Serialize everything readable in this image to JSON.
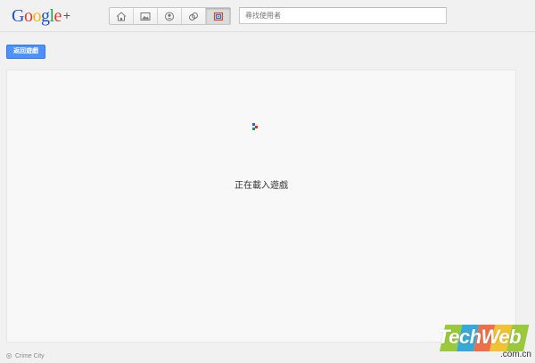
{
  "header": {
    "logo": {
      "letters": [
        "G",
        "o",
        "o",
        "g",
        "l",
        "e"
      ],
      "letter_colors": [
        "#1a52c9",
        "#dd3a2b",
        "#f5b50b",
        "#1a52c9",
        "#1ea54b",
        "#dd3a2b"
      ],
      "plus": "+"
    },
    "nav": [
      {
        "icon": "home-icon",
        "active": false
      },
      {
        "icon": "photos-icon",
        "active": false
      },
      {
        "icon": "profile-icon",
        "active": false
      },
      {
        "icon": "circles-icon",
        "active": false
      },
      {
        "icon": "games-icon",
        "active": true
      }
    ],
    "search": {
      "placeholder": "尋找使用者",
      "value": ""
    }
  },
  "main": {
    "back_button_label": "返回遊戲",
    "loading_text": "正在載入遊戲",
    "spinner_colors": [
      "#2b62d8",
      "#d93025",
      "#0f9d58"
    ],
    "accent": "#4d90fe"
  },
  "footer": {
    "game_name": "Crime City"
  },
  "watermark": {
    "text": "TechWeb",
    "domain": ".com.cn",
    "colors": [
      "#9ac93b",
      "#36a9d7",
      "#ee6f4b",
      "#f2c232",
      "#9ac93b"
    ]
  }
}
